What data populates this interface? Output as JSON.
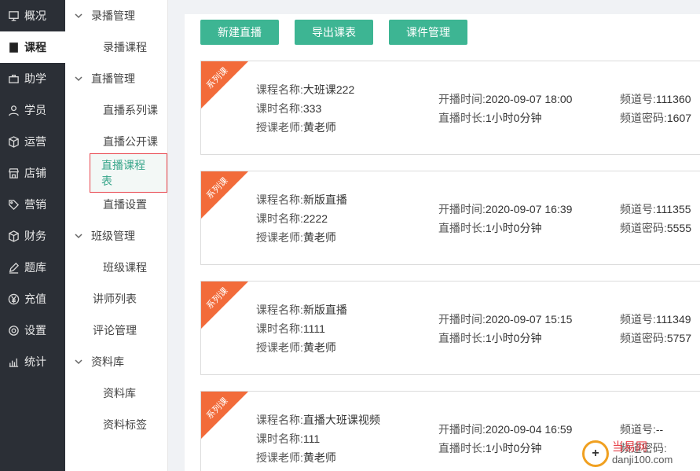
{
  "nav": {
    "items": [
      {
        "label": "概况",
        "icon": "monitor-icon"
      },
      {
        "label": "课程",
        "icon": "book-icon",
        "active": true
      },
      {
        "label": "助学",
        "icon": "briefcase-icon"
      },
      {
        "label": "学员",
        "icon": "user-icon"
      },
      {
        "label": "运营",
        "icon": "cube-icon"
      },
      {
        "label": "店铺",
        "icon": "store-icon"
      },
      {
        "label": "营销",
        "icon": "tag-icon"
      },
      {
        "label": "财务",
        "icon": "box-icon"
      },
      {
        "label": "题库",
        "icon": "pen-icon"
      },
      {
        "label": "充值",
        "icon": "yen-icon"
      },
      {
        "label": "设置",
        "icon": "gear-icon"
      },
      {
        "label": "统计",
        "icon": "bar-chart-icon"
      }
    ]
  },
  "subnav": {
    "recorded_group": "录播管理",
    "recorded_course": "录播课程",
    "live_group": "直播管理",
    "live_series": "直播系列课",
    "live_public": "直播公开课",
    "live_schedule": "直播课程表",
    "live_settings": "直播设置",
    "class_group": "班级管理",
    "class_course": "班级课程",
    "teacher_list": "讲师列表",
    "comment_mgmt": "评论管理",
    "library_group": "资料库",
    "library": "资料库",
    "library_tags": "资料标签"
  },
  "toolbar": {
    "new_live": "新建直播",
    "export": "导出课表",
    "courseware": "课件管理"
  },
  "labels": {
    "ribbon": "系列课",
    "course_name": "课程名称:",
    "lesson_name": "课时名称:",
    "teacher": "授课老师:",
    "start_time": "开播时间:",
    "duration": "直播时长:",
    "channel": "频道号:",
    "channel_pwd": "频道密码:"
  },
  "cards": [
    {
      "course": "大班课222",
      "lesson": "333",
      "teacher": "黄老师",
      "start": "2020-09-07 18:00",
      "duration": "1小时0分钟",
      "channel": "111360",
      "pwd": "1607"
    },
    {
      "course": "新版直播",
      "lesson": "2222",
      "teacher": "黄老师",
      "start": "2020-09-07 16:39",
      "duration": "1小时0分钟",
      "channel": "111355",
      "pwd": "5555"
    },
    {
      "course": "新版直播",
      "lesson": "1111",
      "teacher": "黄老师",
      "start": "2020-09-07 15:15",
      "duration": "1小时0分钟",
      "channel": "111349",
      "pwd": "5757"
    },
    {
      "course": "直播大班课视频",
      "lesson": "111",
      "teacher": "黄老师",
      "start": "2020-09-04 16:59",
      "duration": "1小时0分钟",
      "channel": "--",
      "pwd": ""
    }
  ],
  "watermark": {
    "line1": "当易网",
    "line2": "danji100.com"
  }
}
